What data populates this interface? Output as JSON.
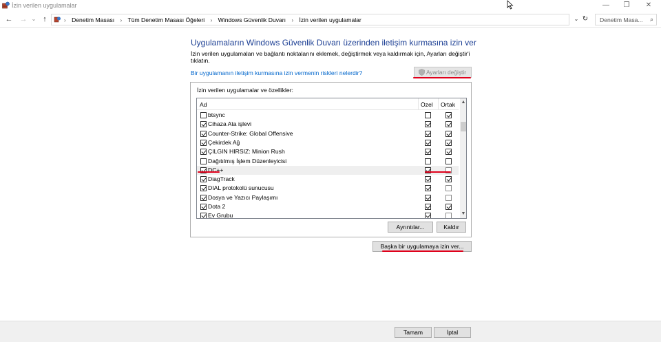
{
  "window": {
    "title": "İzin verilen uygulamalar",
    "minimize": "—",
    "restore": "❐",
    "close": "✕"
  },
  "address": {
    "back": "←",
    "forward": "→",
    "dropdown": "⌄",
    "up": "↑",
    "crumbs": [
      "Denetim Masası",
      "Tüm Denetim Masası Öğeleri",
      "Windows Güvenlik Duvarı",
      "İzin verilen uygulamalar"
    ],
    "crumb_sep": "›",
    "refresh": "↻",
    "search_placeholder": "Denetim Masa...",
    "search_icon": "⌕"
  },
  "main": {
    "heading": "Uygulamaların Windows Güvenlik Duvarı üzerinden iletişim kurmasına izin ver",
    "description": "İzin verilen uygulamaları ve bağlantı noktalarını eklemek, değiştirmek veya kaldırmak için, Ayarları değiştir'i tıklatın.",
    "risk_link": "Bir uygulamanın iletişim kurmasına izin vermenin riskleri nelerdir?",
    "change_settings": "Ayarları değiştir"
  },
  "apps_box": {
    "title": "İzin verilen uygulamalar ve özellikler:",
    "col_name": "Ad",
    "col_private": "Özel",
    "col_public": "Ortak",
    "scroll_up": "▲",
    "scroll_down": "▼",
    "rows": [
      {
        "name": "btsync",
        "enabled": false,
        "private": false,
        "public": true
      },
      {
        "name": "Cihaza Ata işlevi",
        "enabled": true,
        "private": true,
        "public": true
      },
      {
        "name": "Counter-Strike: Global Offensive",
        "enabled": true,
        "private": true,
        "public": true
      },
      {
        "name": "Çekirdek Ağ",
        "enabled": true,
        "private": true,
        "public": true
      },
      {
        "name": "ÇILGIN HIRSIZ: Minion Rush",
        "enabled": true,
        "private": true,
        "public": true
      },
      {
        "name": "Dağıtılmış İşlem Düzenleyicisi",
        "enabled": false,
        "private": false,
        "public": false
      },
      {
        "name": "DC++",
        "enabled": true,
        "private": true,
        "public": false,
        "selected": true
      },
      {
        "name": "DiagTrack",
        "enabled": true,
        "private": true,
        "public": true
      },
      {
        "name": "DIAL protokolü sunucusu",
        "enabled": true,
        "private": true,
        "public": false
      },
      {
        "name": "Dosya ve Yazıcı Paylaşımı",
        "enabled": true,
        "private": true,
        "public": false
      },
      {
        "name": "Dota 2",
        "enabled": true,
        "private": true,
        "public": true
      },
      {
        "name": "Ev Grubu",
        "enabled": true,
        "private": true,
        "public": false
      }
    ],
    "details_button": "Ayrıntılar...",
    "remove_button": "Kaldır"
  },
  "allow_another_button": "Başka bir uygulamaya izin ver...",
  "footer": {
    "ok_button": "Tamam",
    "cancel_button": "İptal"
  }
}
